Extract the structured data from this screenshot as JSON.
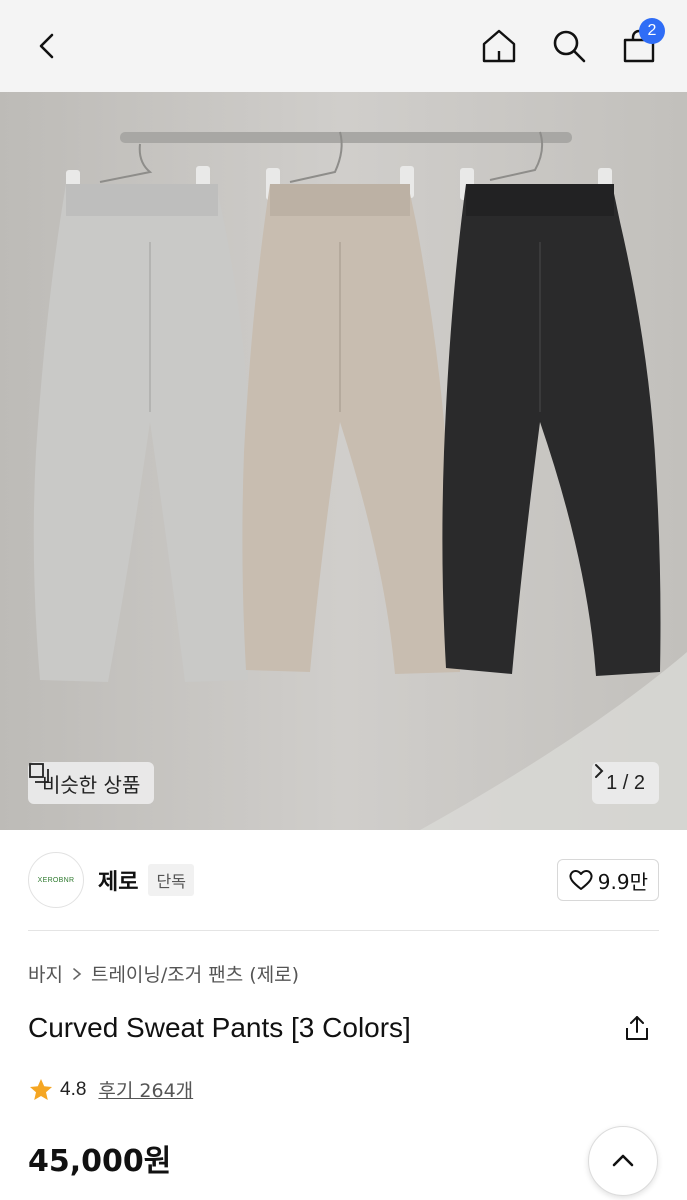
{
  "header": {
    "back_icon": "chevron-left-icon",
    "home_icon": "home-icon",
    "search_icon": "search-icon",
    "cart_icon": "shopping-bag-icon",
    "cart_count": "2",
    "badge_color": "#2f6df6"
  },
  "gallery": {
    "similar_label": "비슷한 상품",
    "pager_text": "1 / 2",
    "image_colors": [
      "#c9c9c7",
      "#c8bdb0",
      "#2a2a2b"
    ]
  },
  "brand": {
    "logo_text": "XEROBNR",
    "name": "제로",
    "exclusive_label": "단독",
    "likes": "9.9만"
  },
  "product": {
    "breadcrumb": [
      "바지",
      "트레이닝/조거 팬츠 (제로)"
    ],
    "title": "Curved Sweat Pants [3 Colors]",
    "rating": "4.8",
    "reviews": "후기 264개",
    "price": "45,000원",
    "star_color": "#f5a623"
  }
}
